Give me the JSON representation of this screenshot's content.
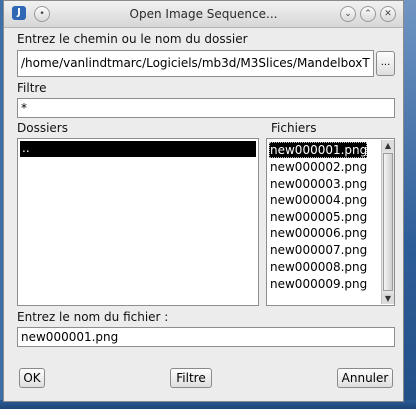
{
  "window": {
    "title": "Open Image Sequence...",
    "app_icon_glyph": "J",
    "buttons": [
      "minimize",
      "maximize",
      "close"
    ]
  },
  "path": {
    "label": "Entrez le chemin ou le nom du dossier",
    "value": "/home/vanlindtmarc/Logiciels/mb3d/M3Slices/MandelboxT",
    "button_label": "..."
  },
  "filter": {
    "label": "Filtre",
    "value": "*"
  },
  "directories": {
    "label": "Dossiers",
    "items": [
      ".."
    ]
  },
  "files": {
    "label": "Fichiers",
    "selected": "new000001.png",
    "items": [
      "new000001.png",
      "new000002.png",
      "new000003.png",
      "new000004.png",
      "new000005.png",
      "new000006.png",
      "new000007.png",
      "new000008.png",
      "new000009.png"
    ]
  },
  "filename": {
    "label": "Entrez le nom du fichier :",
    "value": "new000001.png"
  },
  "footer": {
    "ok_label": "OK",
    "filter_label": "Filtre",
    "cancel_label": "Annuler"
  },
  "icons": {
    "minimize": "chevron-down-icon",
    "maximize": "chevron-up-icon",
    "close": "close-icon",
    "scroll_up": "scroll-up-arrow-icon",
    "scroll_down": "scroll-down-arrow-icon"
  }
}
